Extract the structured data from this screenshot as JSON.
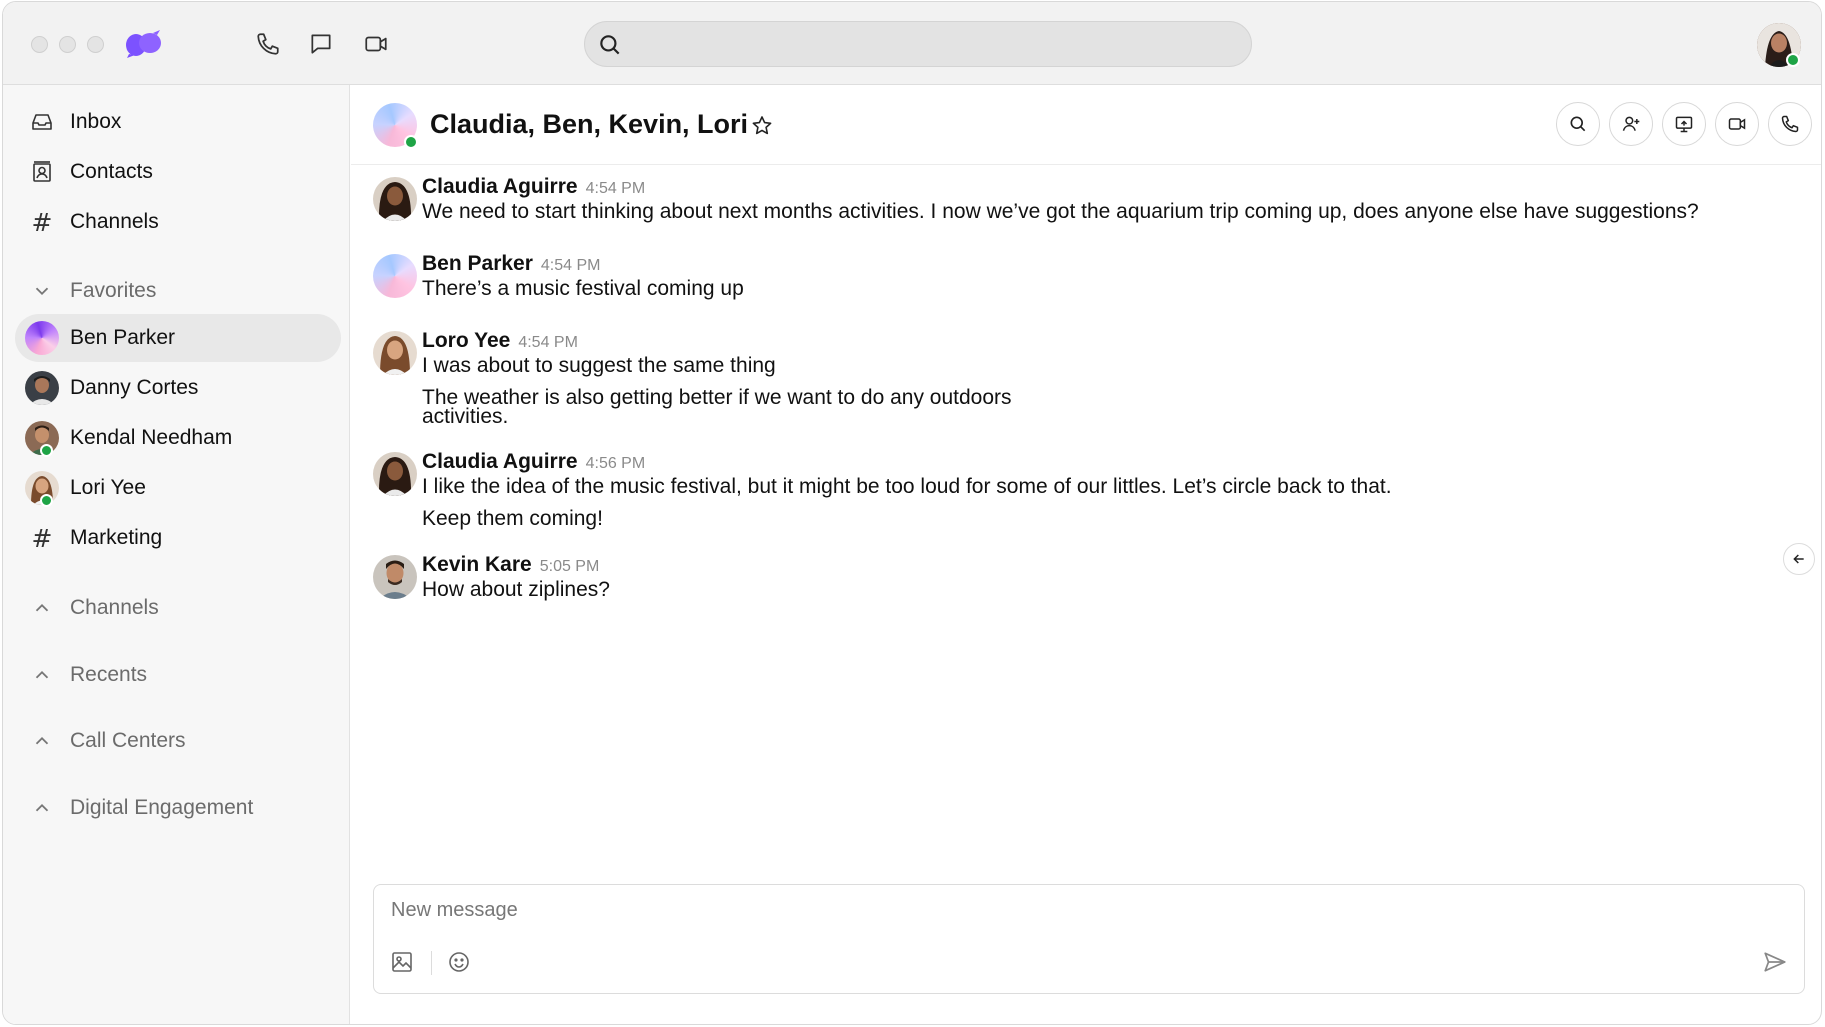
{
  "app": {
    "window_controls": [
      "close",
      "minimize",
      "zoom"
    ],
    "logo_icon": "dialpad-logo-icon",
    "accent_color": "#7c52ff",
    "presence_color": "#1ea446",
    "top_icons": [
      "phone-icon",
      "chat-bubble-icon",
      "video-camera-icon"
    ],
    "search": {
      "placeholder": "",
      "value": ""
    }
  },
  "sidebar": {
    "nav": [
      {
        "label": "Inbox",
        "icon": "inbox-icon"
      },
      {
        "label": "Contacts",
        "icon": "contacts-icon"
      },
      {
        "label": "Channels",
        "icon": "hash-icon"
      }
    ],
    "favorites": {
      "label": "Favorites",
      "expanded": true,
      "items": [
        {
          "label": "Ben Parker",
          "active": true,
          "online": false
        },
        {
          "label": "Danny Cortes",
          "active": false,
          "online": false
        },
        {
          "label": "Kendal Needham",
          "active": false,
          "online": true
        },
        {
          "label": "Lori Yee",
          "active": false,
          "online": true
        },
        {
          "label": "Marketing",
          "type": "channel",
          "icon": "hash-icon"
        }
      ]
    },
    "sections": [
      {
        "label": "Channels",
        "expanded": false
      },
      {
        "label": "Recents",
        "expanded": false
      },
      {
        "label": "Call Centers",
        "expanded": false
      },
      {
        "label": "Digital Engagement",
        "expanded": false
      }
    ]
  },
  "conversation": {
    "title": "Claudia, Ben, Kevin,  Lori",
    "online": true,
    "header_actions": [
      "search-icon",
      "add-person-icon",
      "screen-share-icon",
      "video-camera-icon",
      "phone-icon"
    ],
    "messages": [
      {
        "author": "Claudia Aguirre",
        "time": "4:54 PM",
        "lines": [
          "We need to start thinking about next months activities. I now we’ve got the aquarium trip coming up, does anyone else have suggestions?"
        ]
      },
      {
        "author": "Ben Parker",
        "time": "4:54 PM",
        "lines": [
          "There’s a music festival coming up"
        ]
      },
      {
        "author": "Loro Yee",
        "time": "4:54 PM",
        "lines": [
          "I was about to suggest the same thing",
          "The weather is also getting better if we want to do any outdoors activities."
        ]
      },
      {
        "author": "Claudia Aguirre",
        "time": "4:56 PM",
        "lines": [
          "I like the idea of the music festival, but it might be too loud for some of our littles. Let’s circle back to that.",
          "Keep them coming!"
        ]
      },
      {
        "author": "Kevin Kare",
        "time": "5:05 PM",
        "lines": [
          "How about ziplines?"
        ]
      }
    ],
    "composer": {
      "placeholder": "New message",
      "value": "",
      "icons": [
        "image-icon",
        "emoji-icon",
        "send-icon"
      ]
    }
  }
}
